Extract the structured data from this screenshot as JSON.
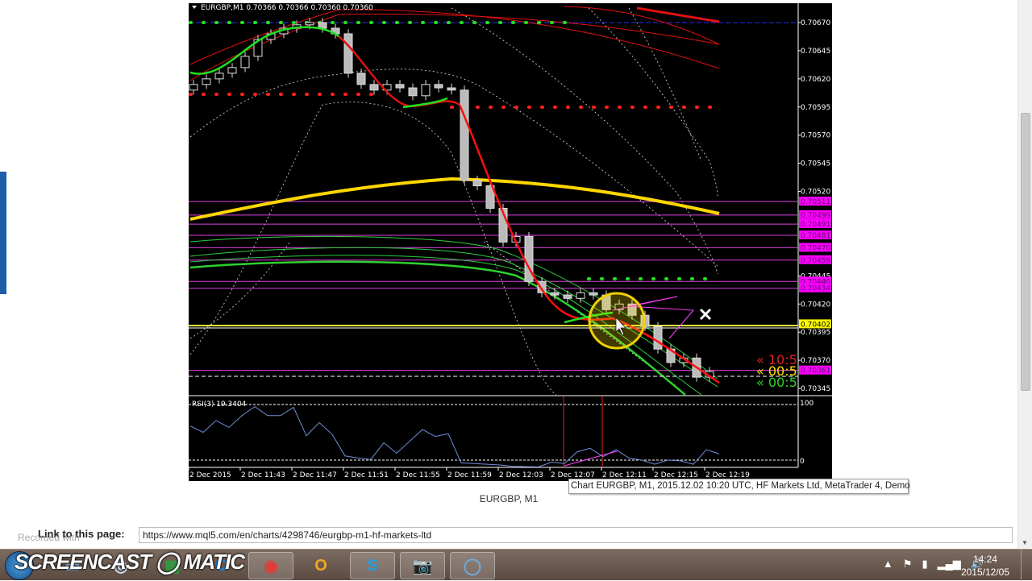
{
  "chart": {
    "header": "EURGBP,M1  0.70366 0.70366 0.70360 0.70360",
    "rsi_label": "RSI(3) 19.3404",
    "rsi_axis": [
      "100",
      "0"
    ],
    "price_axis": [
      "0.70670",
      "0.70645",
      "0.70620",
      "0.70595",
      "0.70570",
      "0.70545",
      "0.70520",
      "0.70445",
      "0.70420",
      "0.70395",
      "0.70370",
      "0.70345"
    ],
    "price_tags": [
      {
        "label": "0.70511",
        "price": 0.70511
      },
      {
        "label": "0.70499",
        "price": 0.70499
      },
      {
        "label": "0.70491",
        "price": 0.70491
      },
      {
        "label": "0.70481",
        "price": 0.70481
      },
      {
        "label": "0.70470",
        "price": 0.7047
      },
      {
        "label": "0.70459",
        "price": 0.70459
      },
      {
        "label": "0.70440",
        "price": 0.7044
      },
      {
        "label": "0.70434",
        "price": 0.70434
      },
      {
        "label": "0.70361",
        "price": 0.70361
      }
    ],
    "bid_tag": {
      "label": "0.70402",
      "price": 0.70402
    },
    "timers": [
      "« 10:5",
      "« 00:5",
      "« 00:5"
    ],
    "time_axis": [
      "2 Dec 2015",
      "2 Dec 11:43",
      "2 Dec 11:47",
      "2 Dec 11:51",
      "2 Dec 11:55",
      "2 Dec 11:59",
      "2 Dec 12:03",
      "2 Dec 12:07",
      "2 Dec 12:11",
      "2 Dec 12:15",
      "2 Dec 12:19"
    ],
    "colors": {
      "bg": "#000000",
      "magenta": "#ff00ff",
      "bid": "#ffff00",
      "rsi": "#6f8fd8"
    }
  },
  "chart_data": {
    "type": "candlestick",
    "symbol": "EURGBP",
    "timeframe": "M1",
    "start_time": "2 Dec 11:39",
    "ylim": [
      0.70335,
      0.70685
    ],
    "close": [
      0.70615,
      0.7062,
      0.70625,
      0.7063,
      0.7064,
      0.70655,
      0.7066,
      0.70665,
      0.70668,
      0.7067,
      0.70665,
      0.7066,
      0.70625,
      0.70615,
      0.7061,
      0.70615,
      0.70612,
      0.70605,
      0.70615,
      0.70612,
      0.7061,
      0.7053,
      0.70525,
      0.70505,
      0.70475,
      0.7048,
      0.7044,
      0.7043,
      0.70428,
      0.70425,
      0.7043,
      0.70428,
      0.70415,
      0.7042,
      0.7041,
      0.704,
      0.7038,
      0.70368,
      0.70372,
      0.70355,
      0.7036
    ],
    "rsi": {
      "period": 3,
      "levels": [
        90,
        10
      ],
      "values": [
        59,
        50,
        67,
        57,
        74,
        87,
        74,
        74,
        86,
        45,
        64,
        47,
        16,
        13,
        11,
        35,
        20,
        37,
        54,
        44,
        48,
        6,
        5,
        4,
        3,
        1,
        0.5,
        0.3,
        7,
        5,
        22,
        27,
        15,
        25,
        13,
        10,
        4,
        10,
        9,
        4,
        25,
        19
      ]
    }
  },
  "caption": "EURGBP, M1",
  "tooltip": "Chart EURGBP, M1, 2015.12.02 10:20 UTC, HF Markets Ltd, MetaTrader 4, Demo",
  "link": {
    "label": "Link to this page:",
    "url": "https://www.mql5.com/en/charts/4298746/eurgbp-m1-hf-markets-ltd"
  },
  "watermark": {
    "recorded": "Recorded with",
    "brand": "SCREENCAST ◯ MATIC"
  },
  "taskbar": {
    "time": "14:24",
    "date": "2015/12/05"
  }
}
